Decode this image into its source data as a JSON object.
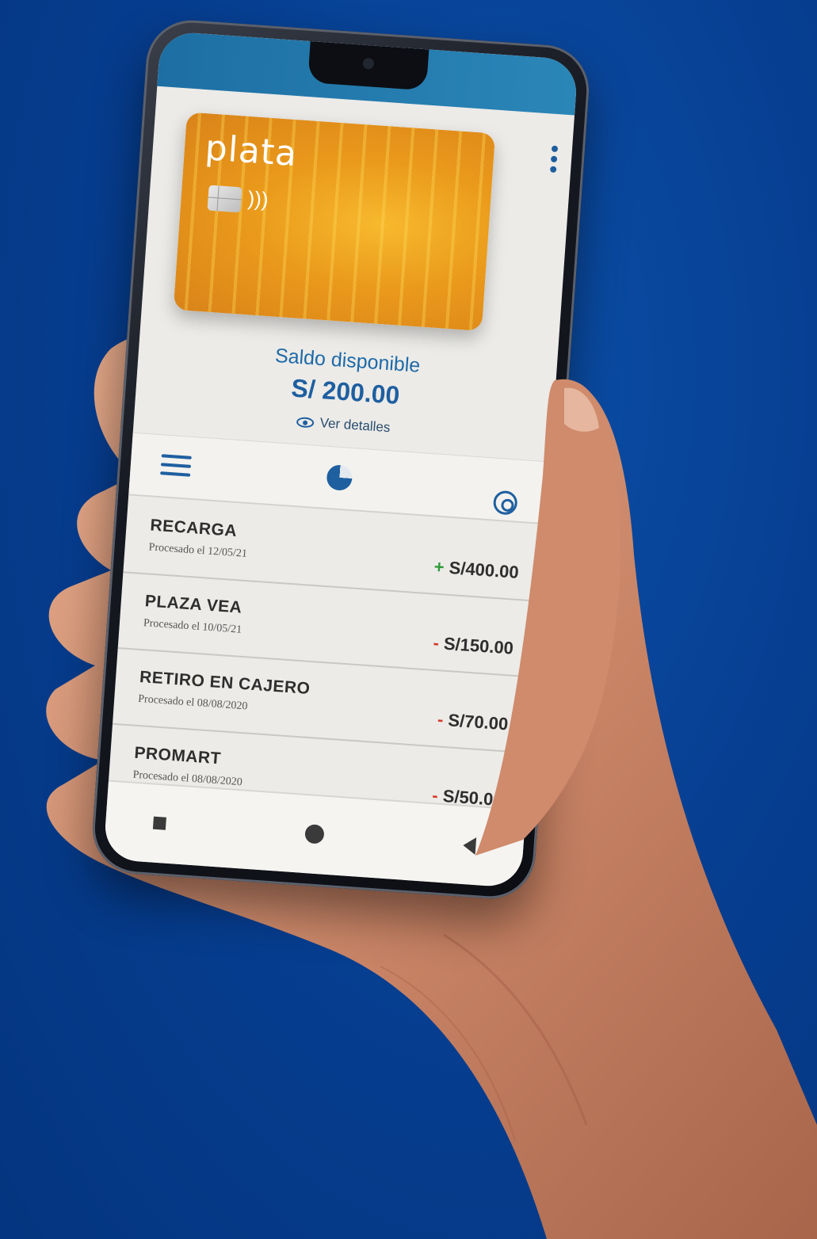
{
  "card": {
    "brand": "plata",
    "contactless_icon": "contactless-icon"
  },
  "balance": {
    "label": "Saldo disponible",
    "value": "S/ 200.00",
    "details_label": "Ver detalles"
  },
  "toolbar": {
    "menu_icon": "hamburger-menu-icon",
    "chart_icon": "pie-chart-icon",
    "settings_icon": "gear-icon"
  },
  "transactions": [
    {
      "title": "RECARGA",
      "subtitle": "Procesado el 12/05/21",
      "sign": "+",
      "amount": "S/400.00"
    },
    {
      "title": "PLAZA VEA",
      "subtitle": "Procesado el 10/05/21",
      "sign": "-",
      "amount": "S/150.00"
    },
    {
      "title": "RETIRO EN CAJERO",
      "subtitle": "Procesado el 08/08/2020",
      "sign": "-",
      "amount": "S/70.00"
    },
    {
      "title": "PROMART",
      "subtitle": "Procesado el 08/08/2020",
      "sign": "-",
      "amount": "S/50.00"
    }
  ],
  "colors": {
    "background": "#063d8f",
    "accent": "#1e5fa0",
    "card": "#ea9a1b",
    "positive": "#2f9b3a",
    "negative": "#d43b2a"
  }
}
